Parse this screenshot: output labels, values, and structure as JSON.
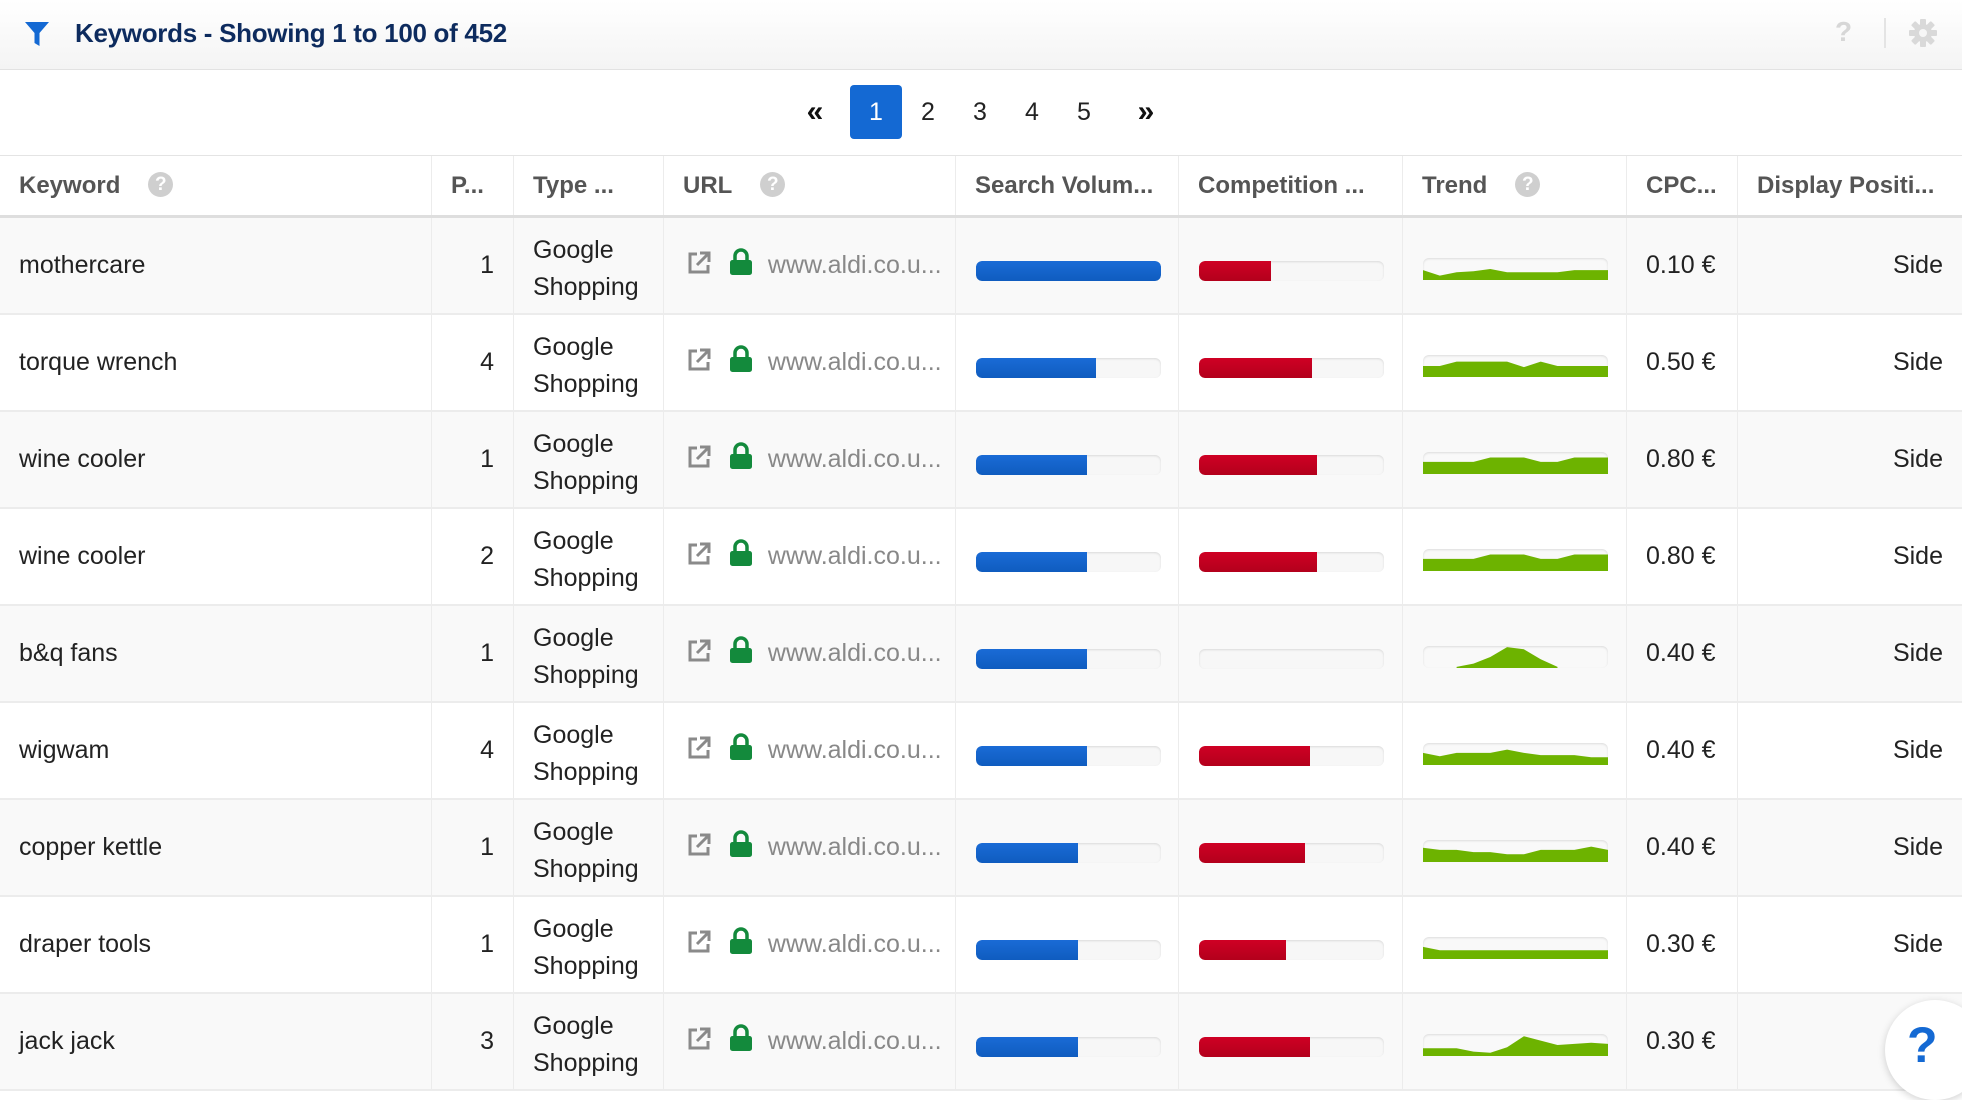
{
  "header": {
    "title": "Keywords - Showing 1 to 100 of 452",
    "filter_icon": "filter-icon",
    "help_icon": "?",
    "settings_icon": "gear-icon"
  },
  "pagination": {
    "first_label": "«",
    "last_label": "»",
    "pages": [
      "1",
      "2",
      "3",
      "4",
      "5"
    ],
    "current_page": "1"
  },
  "columns": {
    "keyword": "Keyword",
    "position": "P...",
    "type": "Type ...",
    "url": "URL",
    "search_volume": "Search Volum...",
    "competition": "Competition ...",
    "trend": "Trend",
    "cpc": "CPC...",
    "display_position": "Display Positi..."
  },
  "help_glyph": "?",
  "colors": {
    "accent": "#1469d3",
    "search_volume_bar": "#1469d3",
    "competition_bar": "#c4001f",
    "trend": "#6db300",
    "lock": "#138a3c"
  },
  "rows": [
    {
      "keyword": "mothercare",
      "position": "1",
      "type": "Google Shopping",
      "url": "www.aldi.co.u...",
      "search_volume": 1.0,
      "competition": 0.39,
      "trend": [
        0.45,
        0.2,
        0.35,
        0.4,
        0.5,
        0.35,
        0.35,
        0.35,
        0.35,
        0.45,
        0.45,
        0.45
      ],
      "cpc": "0.10 €",
      "display_position": "Side"
    },
    {
      "keyword": "torque wrench",
      "position": "4",
      "type": "Google Shopping",
      "url": "www.aldi.co.u...",
      "search_volume": 0.65,
      "competition": 0.61,
      "trend": [
        0.5,
        0.5,
        0.7,
        0.7,
        0.7,
        0.7,
        0.45,
        0.7,
        0.5,
        0.5,
        0.5,
        0.5
      ],
      "cpc": "0.50 €",
      "display_position": "Side"
    },
    {
      "keyword": "wine cooler",
      "position": "1",
      "type": "Google Shopping",
      "url": "www.aldi.co.u...",
      "search_volume": 0.6,
      "competition": 0.64,
      "trend": [
        0.55,
        0.55,
        0.55,
        0.55,
        0.75,
        0.75,
        0.75,
        0.55,
        0.55,
        0.75,
        0.75,
        0.75
      ],
      "cpc": "0.80 €",
      "display_position": "Side"
    },
    {
      "keyword": "wine cooler",
      "position": "2",
      "type": "Google Shopping",
      "url": "www.aldi.co.u...",
      "search_volume": 0.6,
      "competition": 0.64,
      "trend": [
        0.55,
        0.55,
        0.55,
        0.55,
        0.75,
        0.75,
        0.75,
        0.55,
        0.55,
        0.75,
        0.75,
        0.75
      ],
      "cpc": "0.80 €",
      "display_position": "Side"
    },
    {
      "keyword": "b&q fans",
      "position": "1",
      "type": "Google Shopping",
      "url": "www.aldi.co.u...",
      "search_volume": 0.6,
      "competition": 0.0,
      "trend": [
        null,
        null,
        0.05,
        0.2,
        0.5,
        0.95,
        0.85,
        0.4,
        0.05,
        null,
        null,
        null
      ],
      "cpc": "0.40 €",
      "display_position": "Side"
    },
    {
      "keyword": "wigwam",
      "position": "4",
      "type": "Google Shopping",
      "url": "www.aldi.co.u...",
      "search_volume": 0.6,
      "competition": 0.6,
      "trend": [
        0.55,
        0.4,
        0.55,
        0.55,
        0.55,
        0.7,
        0.55,
        0.45,
        0.45,
        0.45,
        0.35,
        0.35
      ],
      "cpc": "0.40 €",
      "display_position": "Side"
    },
    {
      "keyword": "copper kettle",
      "position": "1",
      "type": "Google Shopping",
      "url": "www.aldi.co.u...",
      "search_volume": 0.55,
      "competition": 0.575,
      "trend": [
        0.65,
        0.55,
        0.55,
        0.45,
        0.45,
        0.35,
        0.35,
        0.55,
        0.55,
        0.55,
        0.7,
        0.55
      ],
      "cpc": "0.40 €",
      "display_position": "Side"
    },
    {
      "keyword": "draper tools",
      "position": "1",
      "type": "Google Shopping",
      "url": "www.aldi.co.u...",
      "search_volume": 0.55,
      "competition": 0.47,
      "trend": [
        0.55,
        0.4,
        0.4,
        0.4,
        0.4,
        0.4,
        0.4,
        0.4,
        0.4,
        0.4,
        0.4,
        0.4
      ],
      "cpc": "0.30 €",
      "display_position": "Side"
    },
    {
      "keyword": "jack jack",
      "position": "3",
      "type": "Google Shopping",
      "url": "www.aldi.co.u...",
      "search_volume": 0.55,
      "competition": 0.6,
      "trend": [
        0.35,
        0.35,
        0.35,
        0.2,
        0.15,
        0.4,
        0.9,
        0.7,
        0.5,
        0.55,
        0.6,
        0.55
      ],
      "cpc": "0.30 €",
      "display_position": ""
    }
  ]
}
